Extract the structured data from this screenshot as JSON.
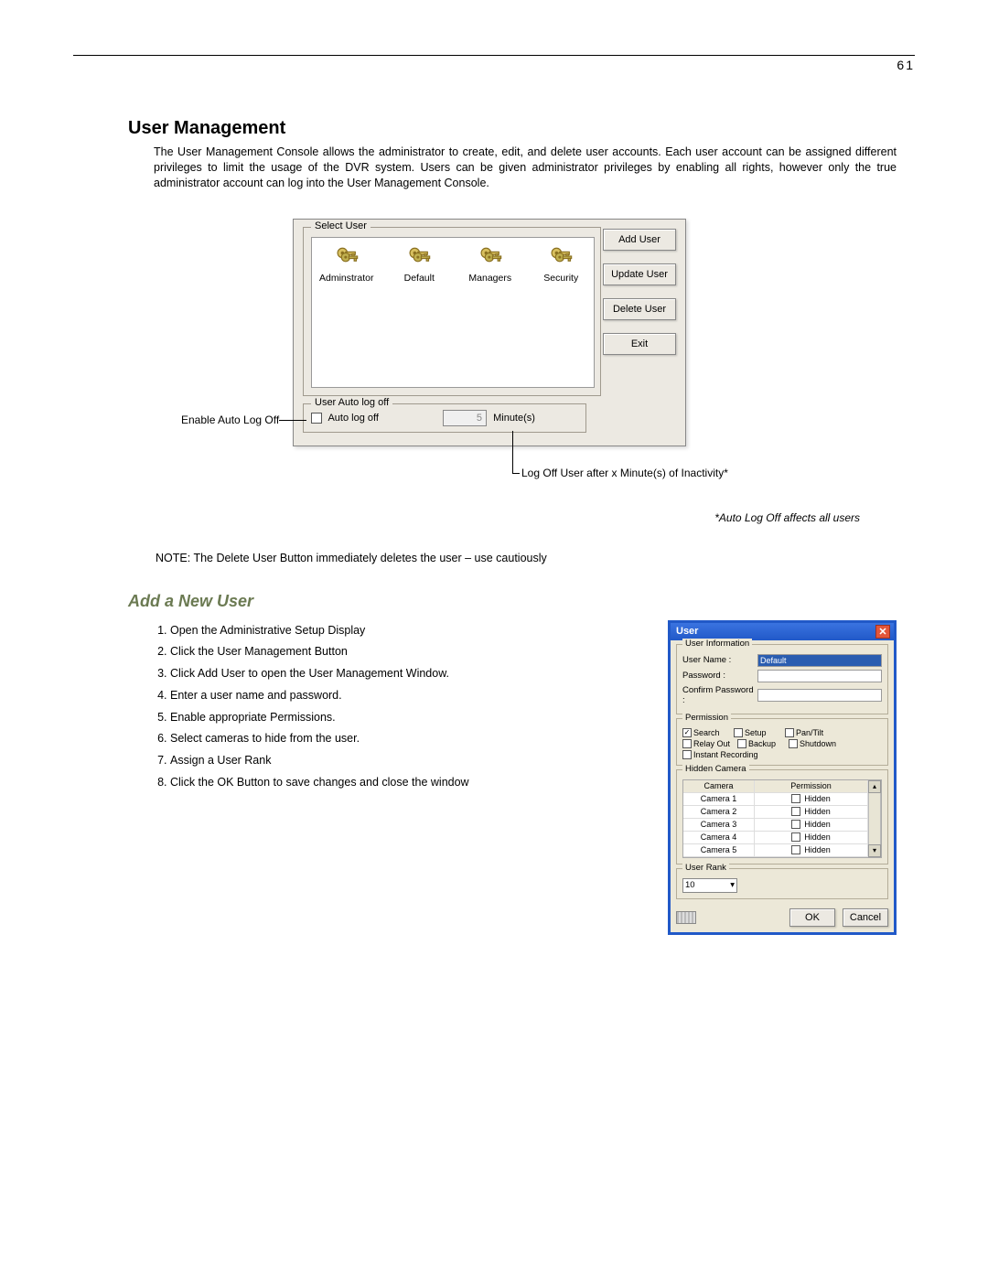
{
  "page_number": "61",
  "section": {
    "title": "User Management",
    "para": "The User Management Console allows the administrator to create, edit, and delete user accounts. Each user account can be assigned different privileges to limit the usage of the DVR system. Users can be given administrator privileges by enabling all rights, however only the true administrator account can log into the User Management Console."
  },
  "dialog1": {
    "select_user_legend": "Select User",
    "users": [
      "Adminstrator",
      "Default",
      "Managers",
      "Security"
    ],
    "buttons": {
      "add": "Add User",
      "update": "Update User",
      "delete": "Delete User",
      "exit": "Exit"
    },
    "autolog": {
      "legend": "User Auto log off",
      "checkbox_label": "Auto log off",
      "minutes_value": "5",
      "minutes_unit": "Minute(s)"
    }
  },
  "callouts": {
    "left": "Enable Auto Log Off",
    "bottom": "Log Off User after x Minute(s) of Inactivity*",
    "footnote": "*Auto Log Off affects all users"
  },
  "note": "NOTE: The Delete User Button immediately deletes the user – use cautiously",
  "subsection": {
    "title": "Add a New User",
    "steps": [
      "Open the Administrative Setup Display",
      "Click the User Management Button",
      "Click Add User to open the User Management Window.",
      "Enter a user name and password.",
      "Enable appropriate Permissions.",
      "Select cameras to hide from the user.",
      "Assign a User Rank",
      "Click the OK Button to save changes and close the window"
    ]
  },
  "user_dialog": {
    "title": "User",
    "user_info": {
      "legend": "User Information",
      "username_label": "User Name :",
      "username_value": "Default",
      "password_label": "Password :",
      "confirm_label": "Confirm Password :"
    },
    "permission": {
      "legend": "Permission",
      "items": [
        {
          "label": "Search",
          "checked": true
        },
        {
          "label": "Setup",
          "checked": false
        },
        {
          "label": "Pan/Tilt",
          "checked": false
        },
        {
          "label": "Relay Out",
          "checked": false
        },
        {
          "label": "Backup",
          "checked": false
        },
        {
          "label": "Shutdown",
          "checked": false
        },
        {
          "label": "Instant Recording",
          "checked": false
        }
      ]
    },
    "hidden_camera": {
      "legend": "Hidden Camera",
      "header": {
        "c1": "Camera",
        "c2": "Permission"
      },
      "rows": [
        {
          "name": "Camera 1",
          "perm": "Hidden"
        },
        {
          "name": "Camera 2",
          "perm": "Hidden"
        },
        {
          "name": "Camera 3",
          "perm": "Hidden"
        },
        {
          "name": "Camera 4",
          "perm": "Hidden"
        },
        {
          "name": "Camera 5",
          "perm": "Hidden"
        }
      ]
    },
    "user_rank": {
      "legend": "User Rank",
      "value": "10"
    },
    "buttons": {
      "ok": "OK",
      "cancel": "Cancel"
    }
  }
}
